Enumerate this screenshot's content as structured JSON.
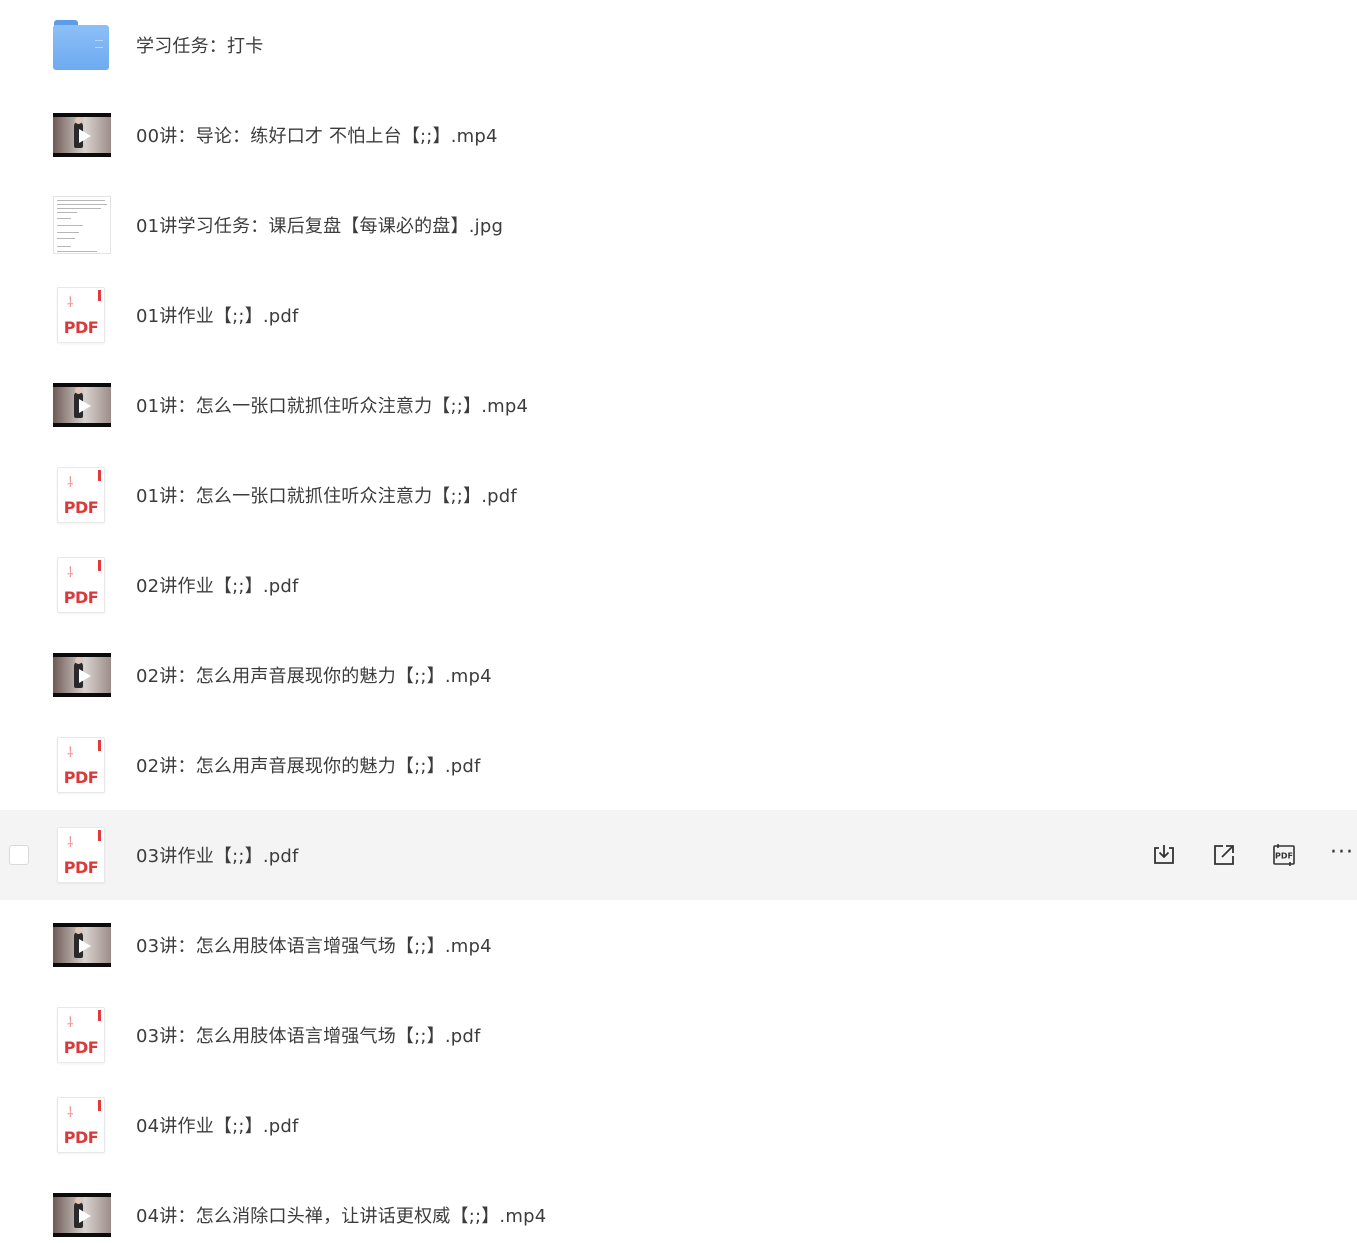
{
  "files": [
    {
      "type": "folder",
      "name": "学习任务：打卡",
      "icon": "folder-icon"
    },
    {
      "type": "video",
      "name": "00讲：导论：练好口才 不怕上台【;;】.mp4",
      "icon": "video-thumbnail"
    },
    {
      "type": "image",
      "name": "01讲学习任务：课后复盘【每课必的盘】.jpg",
      "icon": "image-thumbnail"
    },
    {
      "type": "pdf",
      "name": "01讲作业【;;】.pdf",
      "icon": "pdf-icon",
      "icon_label": "PDF"
    },
    {
      "type": "video",
      "name": "01讲：怎么一张口就抓住听众注意力【;;】.mp4",
      "icon": "video-thumbnail"
    },
    {
      "type": "pdf",
      "name": "01讲：怎么一张口就抓住听众注意力【;;】.pdf",
      "icon": "pdf-icon",
      "icon_label": "PDF"
    },
    {
      "type": "pdf",
      "name": "02讲作业【;;】.pdf",
      "icon": "pdf-icon",
      "icon_label": "PDF"
    },
    {
      "type": "video",
      "name": "02讲：怎么用声音展现你的魅力【;;】.mp4",
      "icon": "video-thumbnail"
    },
    {
      "type": "pdf",
      "name": "02讲：怎么用声音展现你的魅力【;;】.pdf",
      "icon": "pdf-icon",
      "icon_label": "PDF"
    },
    {
      "type": "pdf",
      "name": "03讲作业【;;】.pdf",
      "icon": "pdf-icon",
      "icon_label": "PDF",
      "hovered": true
    },
    {
      "type": "video",
      "name": "03讲：怎么用肢体语言增强气场【;;】.mp4",
      "icon": "video-thumbnail"
    },
    {
      "type": "pdf",
      "name": "03讲：怎么用肢体语言增强气场【;;】.pdf",
      "icon": "pdf-icon",
      "icon_label": "PDF"
    },
    {
      "type": "pdf",
      "name": "04讲作业【;;】.pdf",
      "icon": "pdf-icon",
      "icon_label": "PDF"
    },
    {
      "type": "video",
      "name": "04讲：怎么消除口头禅，让讲话更权威【;;】.mp4",
      "icon": "video-thumbnail"
    }
  ],
  "hover_actions": [
    {
      "name": "download-icon"
    },
    {
      "name": "share-icon"
    },
    {
      "name": "convert-pdf-icon"
    },
    {
      "name": "more-icon",
      "glyph": "···"
    }
  ],
  "colors": {
    "hover_row": "#f4f4f4",
    "pdf_red": "#dc3a3a",
    "folder_blue": "#6daaf0",
    "text": "#3c3c3c"
  }
}
